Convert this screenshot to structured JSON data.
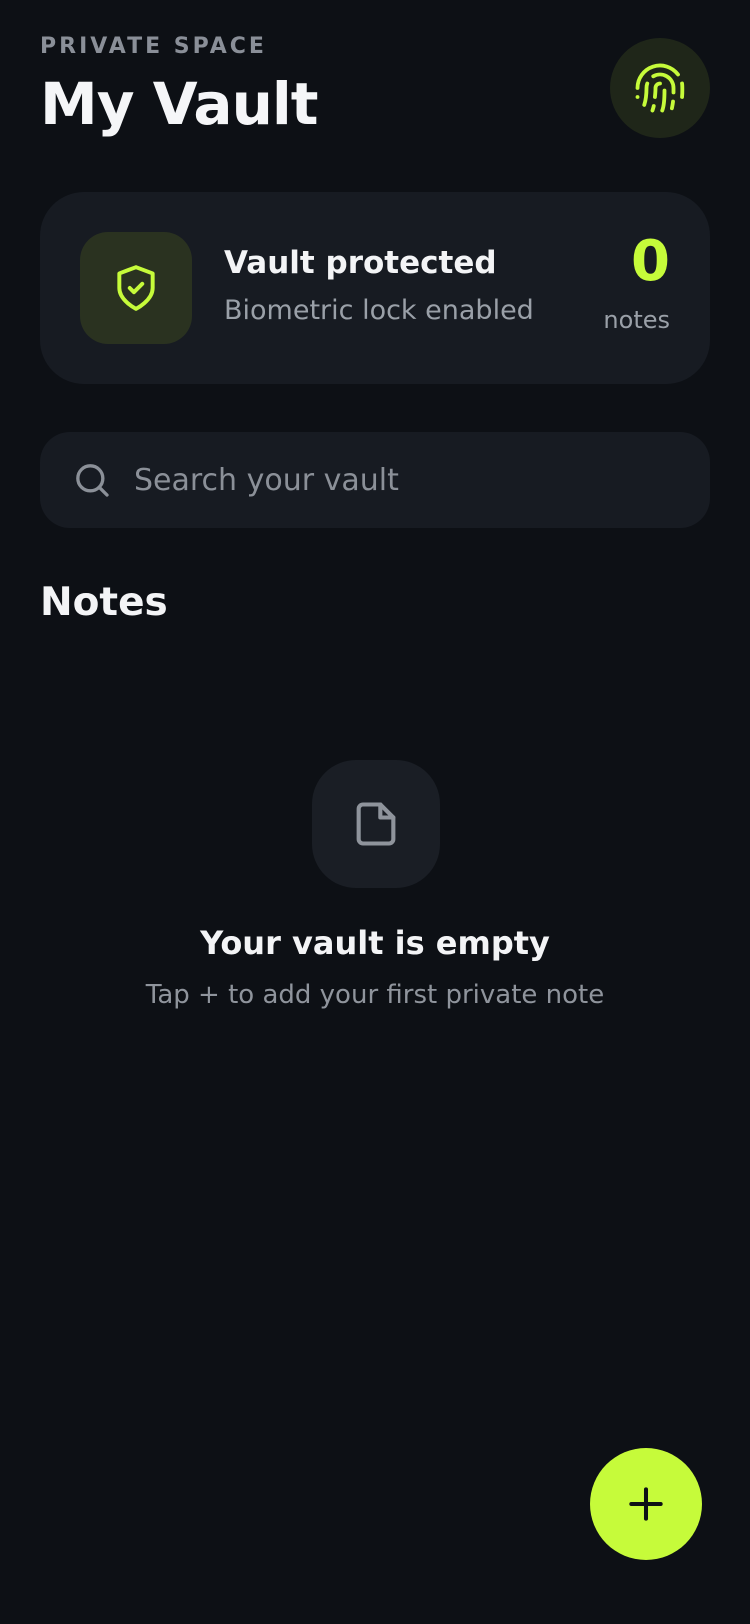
{
  "header": {
    "eyebrow": "PRIVATE SPACE",
    "title": "My Vault",
    "action_icon": "fingerprint-icon"
  },
  "status_card": {
    "icon": "shield-check-icon",
    "title": "Vault protected",
    "subtitle": "Biometric lock enabled",
    "count_value": "0",
    "count_label": "notes"
  },
  "search": {
    "icon": "search-icon",
    "placeholder": "Search your vault",
    "value": ""
  },
  "notes_section": {
    "title": "Notes"
  },
  "empty_state": {
    "icon": "document-icon",
    "title": "Your vault is empty",
    "subtitle": "Tap + to add your first private note"
  },
  "fab": {
    "icon": "plus-icon"
  },
  "colors": {
    "background": "#0d1015",
    "surface": "#171b22",
    "accent": "#c6fb3a",
    "text_primary": "#f3f4f6",
    "text_secondary": "#9aa0a8"
  }
}
